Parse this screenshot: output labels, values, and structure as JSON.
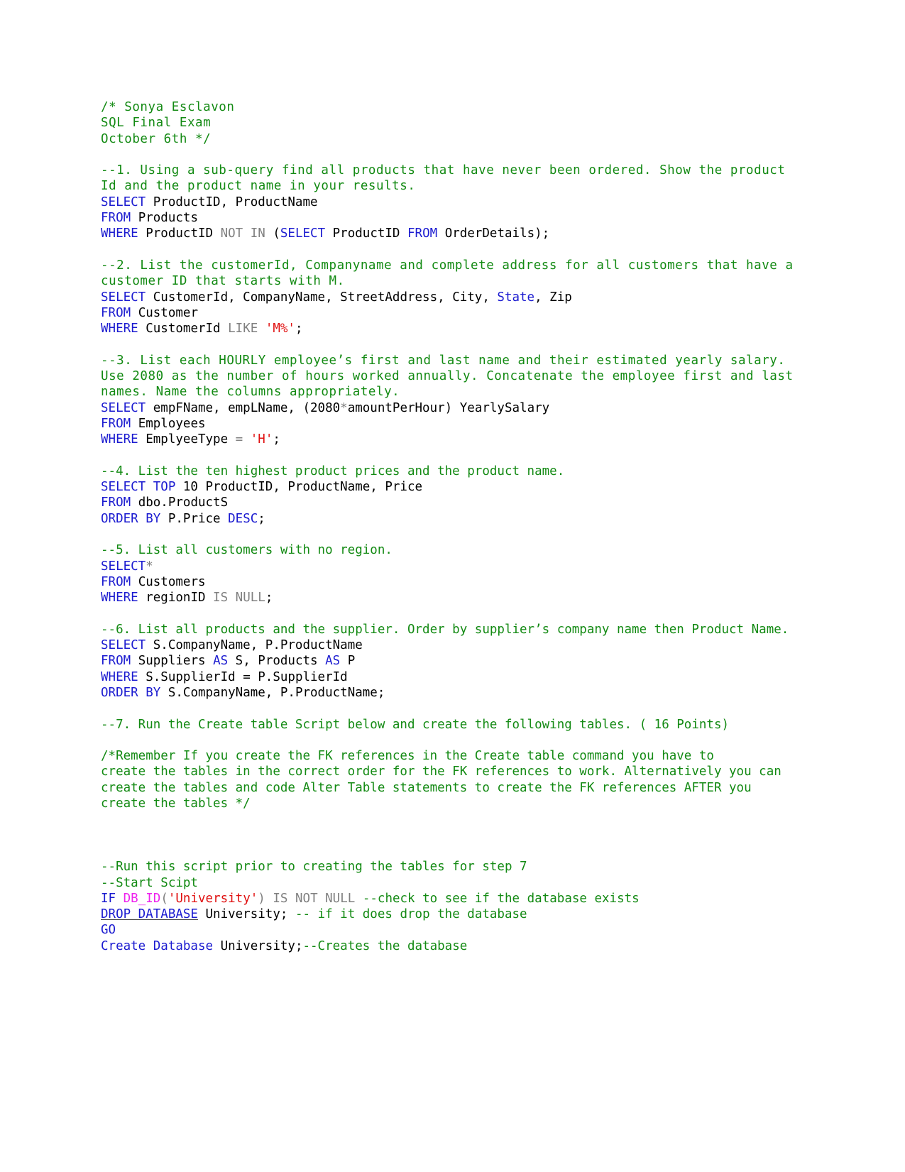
{
  "document": {
    "kind": "sql-script",
    "colors": {
      "comment": "#138a13",
      "keyword": "#1b1bd0",
      "plain": "#000000",
      "operator": "#808080",
      "string": "#e01010",
      "function": "#ee22ee",
      "background": "#ffffff"
    },
    "header": {
      "line1": "/* Sonya Esclavon",
      "line2": "SQL Final Exam",
      "line3": "October 6th */"
    },
    "questions": [
      {
        "id": "q1",
        "prompt": "--1. Using a sub-query find all products that have never been ordered. Show the product Id and the product name in your results.",
        "sql": [
          {
            "tokens": [
              {
                "t": "SELECT",
                "c": "keyword"
              },
              {
                "t": " ProductID, ProductName",
                "c": "plain"
              }
            ]
          },
          {
            "tokens": [
              {
                "t": "FROM",
                "c": "keyword"
              },
              {
                "t": " Products",
                "c": "plain"
              }
            ]
          },
          {
            "tokens": [
              {
                "t": "WHERE",
                "c": "keyword"
              },
              {
                "t": " ProductID ",
                "c": "plain"
              },
              {
                "t": "NOT IN",
                "c": "operator"
              },
              {
                "t": " (",
                "c": "plain"
              },
              {
                "t": "SELECT",
                "c": "keyword"
              },
              {
                "t": " ProductID ",
                "c": "plain"
              },
              {
                "t": "FROM",
                "c": "keyword"
              },
              {
                "t": " OrderDetails);",
                "c": "plain"
              }
            ]
          }
        ]
      },
      {
        "id": "q2",
        "prompt": "--2. List the customerId, Companyname and complete address for all customers that have a customer ID that starts with M.",
        "sql": [
          {
            "tokens": [
              {
                "t": "SELECT",
                "c": "keyword"
              },
              {
                "t": " CustomerId, CompanyName, StreetAddress, City, ",
                "c": "plain"
              },
              {
                "t": "State",
                "c": "keyword"
              },
              {
                "t": ", Zip",
                "c": "plain"
              }
            ]
          },
          {
            "tokens": [
              {
                "t": "FROM",
                "c": "keyword"
              },
              {
                "t": " Customer",
                "c": "plain"
              }
            ]
          },
          {
            "tokens": [
              {
                "t": "WHERE",
                "c": "keyword"
              },
              {
                "t": " CustomerId ",
                "c": "plain"
              },
              {
                "t": "LIKE",
                "c": "operator"
              },
              {
                "t": " ",
                "c": "plain"
              },
              {
                "t": "'M%'",
                "c": "string"
              },
              {
                "t": ";",
                "c": "plain"
              }
            ]
          }
        ]
      },
      {
        "id": "q3",
        "prompt": "--3. List each HOURLY employee’s first and last name and their estimated yearly salary. Use 2080 as the number of hours worked annually. Concatenate the employee first and last names. Name the columns appropriately.",
        "sql": [
          {
            "tokens": [
              {
                "t": "SELECT",
                "c": "keyword"
              },
              {
                "t": " empFName, empLName, (2080",
                "c": "plain"
              },
              {
                "t": "*",
                "c": "operator"
              },
              {
                "t": "amountPerHour) YearlySalary",
                "c": "plain"
              }
            ]
          },
          {
            "tokens": [
              {
                "t": "FROM",
                "c": "keyword"
              },
              {
                "t": " Employees",
                "c": "plain"
              }
            ]
          },
          {
            "tokens": [
              {
                "t": "WHERE",
                "c": "keyword"
              },
              {
                "t": " EmplyeeType ",
                "c": "plain"
              },
              {
                "t": "=",
                "c": "operator"
              },
              {
                "t": " ",
                "c": "plain"
              },
              {
                "t": "'H'",
                "c": "string"
              },
              {
                "t": ";",
                "c": "plain"
              }
            ]
          }
        ]
      },
      {
        "id": "q4",
        "prompt": "--4. List the ten highest product prices and the product name.",
        "sql": [
          {
            "tokens": [
              {
                "t": "SELECT TOP",
                "c": "keyword"
              },
              {
                "t": " 10 ProductID, ProductName, Price",
                "c": "plain"
              }
            ]
          },
          {
            "tokens": [
              {
                "t": "FROM",
                "c": "keyword"
              },
              {
                "t": " dbo.ProductS",
                "c": "plain"
              }
            ]
          },
          {
            "tokens": [
              {
                "t": "ORDER BY",
                "c": "keyword"
              },
              {
                "t": " P.Price ",
                "c": "plain"
              },
              {
                "t": "DESC",
                "c": "keyword"
              },
              {
                "t": ";",
                "c": "plain"
              }
            ]
          }
        ]
      },
      {
        "id": "q5",
        "prompt": "--5. List all customers with no region.",
        "sql": [
          {
            "tokens": [
              {
                "t": "SELECT",
                "c": "keyword"
              },
              {
                "t": "*",
                "c": "operator"
              }
            ]
          },
          {
            "tokens": [
              {
                "t": "FROM",
                "c": "keyword"
              },
              {
                "t": " Customers",
                "c": "plain"
              }
            ]
          },
          {
            "tokens": [
              {
                "t": "WHERE",
                "c": "keyword"
              },
              {
                "t": " regionID ",
                "c": "plain"
              },
              {
                "t": "IS NULL",
                "c": "operator"
              },
              {
                "t": ";",
                "c": "plain"
              }
            ]
          }
        ]
      },
      {
        "id": "q6",
        "prompt": "--6. List all products and the supplier. Order by supplier’s company name then Product Name.",
        "sql": [
          {
            "tokens": [
              {
                "t": "SELECT",
                "c": "keyword"
              },
              {
                "t": " S.CompanyName, P.ProductName",
                "c": "plain"
              }
            ]
          },
          {
            "tokens": [
              {
                "t": "FROM",
                "c": "keyword"
              },
              {
                "t": " Suppliers ",
                "c": "plain"
              },
              {
                "t": "AS",
                "c": "keyword"
              },
              {
                "t": " S, Products ",
                "c": "plain"
              },
              {
                "t": "AS",
                "c": "keyword"
              },
              {
                "t": " P",
                "c": "plain"
              }
            ]
          },
          {
            "tokens": [
              {
                "t": "WHERE",
                "c": "keyword"
              },
              {
                "t": " S.SupplierId = P.SupplierId",
                "c": "plain"
              }
            ]
          },
          {
            "tokens": [
              {
                "t": "ORDER BY",
                "c": "keyword"
              },
              {
                "t": " S.CompanyName, P.ProductName;",
                "c": "plain"
              }
            ]
          }
        ]
      },
      {
        "id": "q7",
        "prompt": "--7. Run the Create table Script below and create the following tables. ( 16 Points)",
        "sql": []
      }
    ],
    "block_comment": {
      "lines": [
        "/*Remember If you create the FK references in the Create table command you have to",
        "create the tables in the correct order for the FK references to work. Alternatively you can",
        "create the tables and code Alter Table statements to create the FK references AFTER you",
        "create the tables */"
      ]
    },
    "script_section": {
      "comment1": "--Run this script prior to creating the tables for step 7",
      "comment2": "--Start Scipt",
      "lines": [
        {
          "id": "if-db-id",
          "tokens": [
            {
              "t": "IF",
              "c": "keyword"
            },
            {
              "t": " ",
              "c": "plain"
            },
            {
              "t": "DB_ID",
              "c": "function"
            },
            {
              "t": "(",
              "c": "operator"
            },
            {
              "t": "'University'",
              "c": "string"
            },
            {
              "t": ")",
              "c": "operator"
            },
            {
              "t": " ",
              "c": "plain"
            },
            {
              "t": "IS NOT NULL",
              "c": "operator"
            },
            {
              "t": " ",
              "c": "plain"
            },
            {
              "t": "--check to see if the database exists",
              "c": "comment"
            }
          ]
        },
        {
          "id": "drop-database",
          "tokens": [
            {
              "t": "DROP DATABASE",
              "c": "keyword",
              "underline": true
            },
            {
              "t": " University;",
              "c": "plain"
            },
            {
              "t": " ",
              "c": "plain"
            },
            {
              "t": "-- if it does drop the database",
              "c": "comment"
            }
          ]
        },
        {
          "id": "go",
          "tokens": [
            {
              "t": "GO",
              "c": "keyword"
            }
          ]
        },
        {
          "id": "create-database",
          "tokens": [
            {
              "t": "Create Database",
              "c": "keyword"
            },
            {
              "t": " University;",
              "c": "plain"
            },
            {
              "t": "--Creates the database",
              "c": "comment"
            }
          ]
        }
      ]
    }
  }
}
